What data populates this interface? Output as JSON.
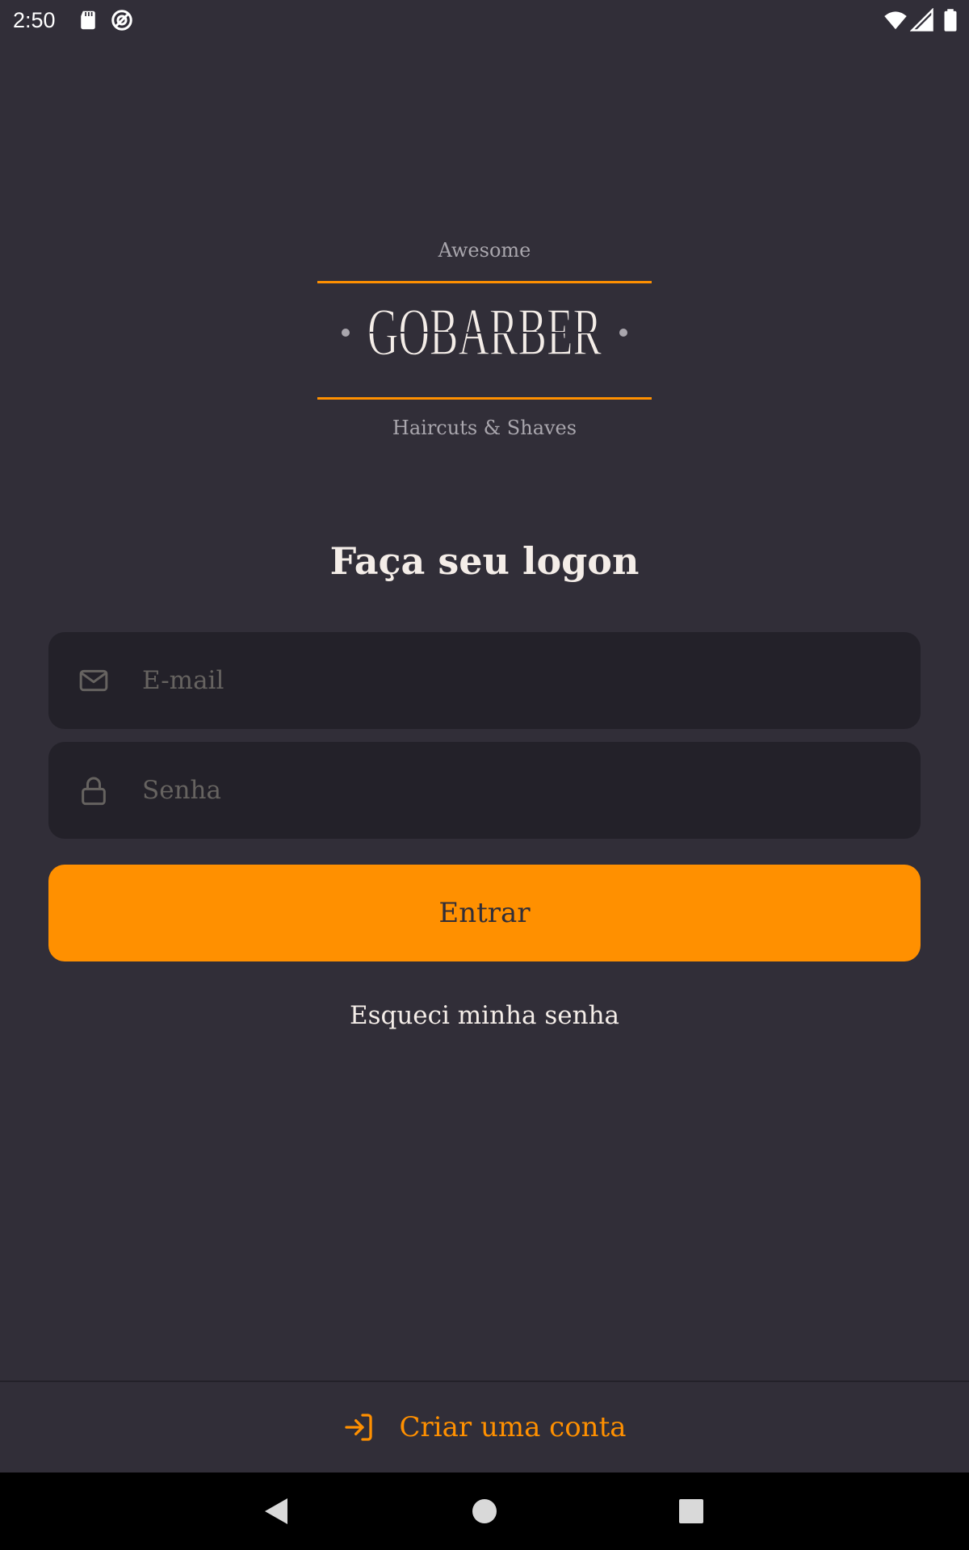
{
  "status_bar": {
    "time": "2:50",
    "icons": [
      "sd-card-icon",
      "data-saver-icon",
      "wifi-icon",
      "cell-signal-icon",
      "battery-icon"
    ]
  },
  "logo": {
    "top_text": "Awesome",
    "word": "GOBARBER",
    "bottom_text": "Haircuts & Shaves",
    "line_color": "#ff9000"
  },
  "title": "Faça seu logon",
  "email": {
    "placeholder": "E-mail",
    "value": "",
    "icon": "mail-icon"
  },
  "password": {
    "placeholder": "Senha",
    "value": "",
    "icon": "lock-icon"
  },
  "submit_label": "Entrar",
  "forgot_label": "Esqueci minha senha",
  "footer": {
    "create_account_label": "Criar uma conta",
    "icon": "log-in-icon"
  },
  "nav": {
    "buttons": [
      "back-icon",
      "home-icon",
      "recents-icon"
    ]
  },
  "colors": {
    "background": "#312e38",
    "input_background": "#232129",
    "accent": "#ff9000",
    "text": "#f4ede8",
    "placeholder": "#666360"
  }
}
